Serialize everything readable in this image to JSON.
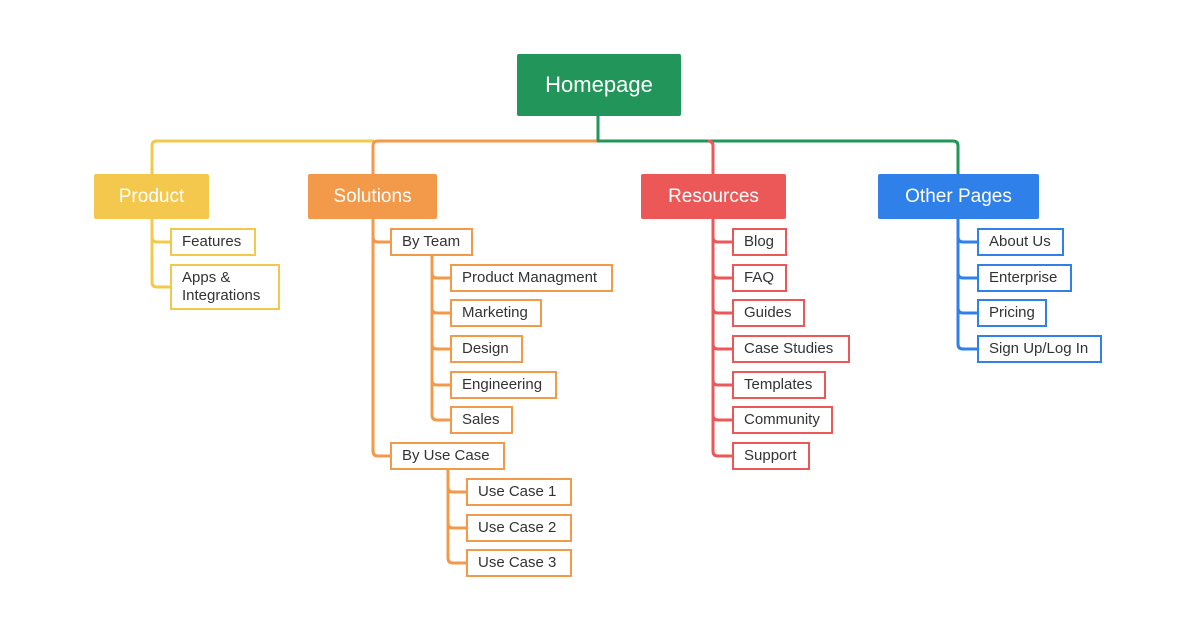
{
  "root": {
    "label": "Homepage",
    "color": "#22965a"
  },
  "categories": [
    {
      "label": "Product",
      "color": "#f4c84c",
      "children": [
        {
          "label": "Features"
        },
        {
          "label": "Apps & Integrations"
        }
      ]
    },
    {
      "label": "Solutions",
      "color": "#f3994a",
      "children": [
        {
          "label": "By Team",
          "children": [
            {
              "label": "Product Managment"
            },
            {
              "label": "Marketing"
            },
            {
              "label": "Design"
            },
            {
              "label": "Engineering"
            },
            {
              "label": "Sales"
            }
          ]
        },
        {
          "label": "By Use Case",
          "children": [
            {
              "label": "Use Case 1"
            },
            {
              "label": "Use Case 2"
            },
            {
              "label": "Use Case 3"
            }
          ]
        }
      ]
    },
    {
      "label": "Resources",
      "color": "#ec5858",
      "children": [
        {
          "label": "Blog"
        },
        {
          "label": "FAQ"
        },
        {
          "label": "Guides"
        },
        {
          "label": "Case Studies"
        },
        {
          "label": "Templates"
        },
        {
          "label": "Community"
        },
        {
          "label": "Support"
        }
      ]
    },
    {
      "label": "Other Pages",
      "color": "#2f80e8",
      "children": [
        {
          "label": "About Us"
        },
        {
          "label": "Enterprise"
        },
        {
          "label": "Pricing"
        },
        {
          "label": "Sign Up/Log In"
        }
      ]
    }
  ]
}
